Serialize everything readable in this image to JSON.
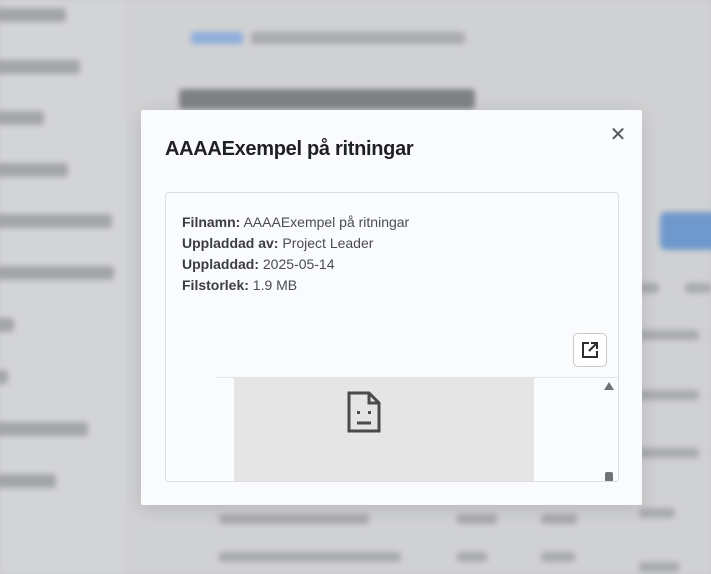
{
  "modal": {
    "title": "AAAAExempel på ritningar",
    "close_symbol": "✕",
    "metadata": {
      "filename_label": "Filnamn:",
      "filename_value": "AAAAExempel på ritningar",
      "uploaded_by_label": "Uppladdad av:",
      "uploaded_by_value": "Project Leader",
      "uploaded_label": "Uppladdad:",
      "uploaded_value": "2025-05-14",
      "filesize_label": "Filstorlek:",
      "filesize_value": "1.9 MB"
    },
    "open_external_icon": "external-link-icon",
    "preview_icon": "broken-document-icon"
  },
  "colors": {
    "backdrop": "#c9cacd",
    "modal_bg": "#fafbfc",
    "title_text": "#1f2023",
    "preview_bg": "#e5e5e5",
    "background_accent_button": "#6f99cc"
  }
}
